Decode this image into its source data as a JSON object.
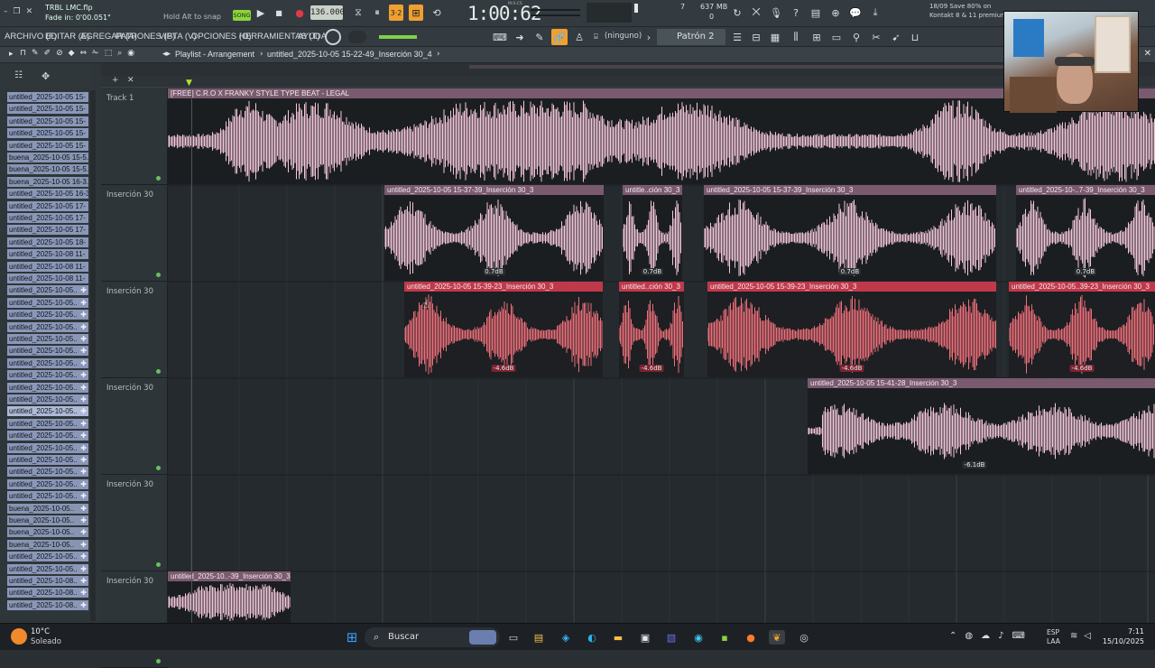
{
  "topbar": {
    "file_name": "TRBL LMC.flp",
    "hint": "Fade in: 0'00.051\"",
    "snap_hint": "Hold Alt to snap",
    "song_label": "SONG",
    "tempo": "136.000",
    "time": "1:00:62",
    "time_unit": "M:S:CS",
    "memory": "637 MB",
    "cpu_line1": "7",
    "cpu_line2": "0",
    "news_line1": "18/09  Save 80% on",
    "news_line2": "Kontakt 8 & 11 premium"
  },
  "menu": {
    "items": [
      "ARCHIVO (F)",
      "EDITAR (E)",
      "AGREGAR (A)",
      "PATRONES (P)",
      "VISTA (V)",
      "OPCIONES (O)",
      "HERRAMIENTAS (T)",
      "AYUDA"
    ],
    "none_label": "(ninguno)",
    "pattern_label": "Patrón 2"
  },
  "playlist": {
    "breadcrumb": "Playlist - Arrangement",
    "current_clip": "untitled_2025-10-05 15-22-49_Inserción 30_4"
  },
  "browser": {
    "items": [
      "untitled_2025-10-05 15-",
      "untitled_2025-10-05 15-",
      "untitled_2025-10-05 15-",
      "untitled_2025-10-05 15-",
      "untitled_2025-10-05 15-",
      "buena_2025-10-05 15-5.",
      "buena_2025-10-05 15-5.",
      "buena_2025-10-05 16-3.",
      "untitled_2025-10-05 16-3",
      "untitled_2025-10-05 17-",
      "untitled_2025-10-05 17-",
      "untitled_2025-10-05 17-",
      "untitled_2025-10-05 18-",
      "untitled_2025-10-08 11-",
      "untitled_2025-10-08 11-",
      "untitled_2025-10-08 11-",
      "untitled_2025-10-05..",
      "untitled_2025-10-05..",
      "untitled_2025-10-05..",
      "untitled_2025-10-05..",
      "untitled_2025-10-05..",
      "untitled_2025-10-05..",
      "untitled_2025-10-05..",
      "untitled_2025-10-05..",
      "untitled_2025-10-05..",
      "untitled_2025-10-05..",
      "untitled_2025-10-05..",
      "untitled_2025-10-05..",
      "untitled_2025-10-05..",
      "untitled_2025-10-05..",
      "untitled_2025-10-05..",
      "untitled_2025-10-05..",
      "untitled_2025-10-05..",
      "untitled_2025-10-05..",
      "buena_2025-10-05..",
      "buena_2025-10-05..",
      "buena_2025-10-05..",
      "buena_2025-10-05..",
      "untitled_2025-10-05..",
      "untitled_2025-10-05..",
      "untitled_2025-10-08..",
      "untitled_2025-10-08..",
      "untitled_2025-10-08.."
    ]
  },
  "tracks": [
    {
      "name": "Track 1"
    },
    {
      "name": "Inserción 30"
    },
    {
      "name": "Inserción 30"
    },
    {
      "name": "Inserción 30"
    },
    {
      "name": "Inserción 30"
    },
    {
      "name": "Inserción 30"
    }
  ],
  "clips": {
    "beat": "[FREE] C.R.O X FRANKY STYLE TYPE BEAT - LEGAL",
    "row2": [
      {
        "title": "untitled_2025-10-05 15-37-39_Inserción 30_3",
        "db": "0.7dB"
      },
      {
        "title": "untitle..ción 30_3",
        "db": "0.7dB"
      },
      {
        "title": "untitled_2025-10-05 15-37-39_Inserción 30_3",
        "db": "0.7dB"
      },
      {
        "title": "untitled_2025-10-..7-39_Inserción 30_3",
        "db": "0.7dB"
      }
    ],
    "row3": [
      {
        "title": "untitled_2025-10-05 15-39-23_Inserción 30_3",
        "db": "-4.6dB"
      },
      {
        "title": "untitled..ción 30_3",
        "db": "-4.6dB"
      },
      {
        "title": "untitled_2025-10-05 15-39-23_Inserción 30_3",
        "db": "-4.6dB"
      },
      {
        "title": "untitled_2025-10-05..39-23_Inserción 30_3",
        "db": "-4.6dB"
      }
    ],
    "row4": {
      "title": "untitled_2025-10-05 15-41-28_Inserción 30_3",
      "db": "-6.1dB"
    },
    "row6": {
      "title": "untitled_2025-10..-39_Inserción 30_3"
    }
  },
  "taskbar": {
    "weather_temp": "10°C",
    "weather_text": "Soleado",
    "search_label": "Buscar",
    "lang1": "ESP",
    "lang2": "LAA",
    "clock_time": "7:11",
    "clock_date": "15/10/2025"
  },
  "colors": {
    "accent_orange": "#f0a030",
    "clip_pink": "#f3c6d9",
    "clip_red": "#ee6f7a",
    "header_red": "#c0394a",
    "song_green": "#8bd53c"
  }
}
